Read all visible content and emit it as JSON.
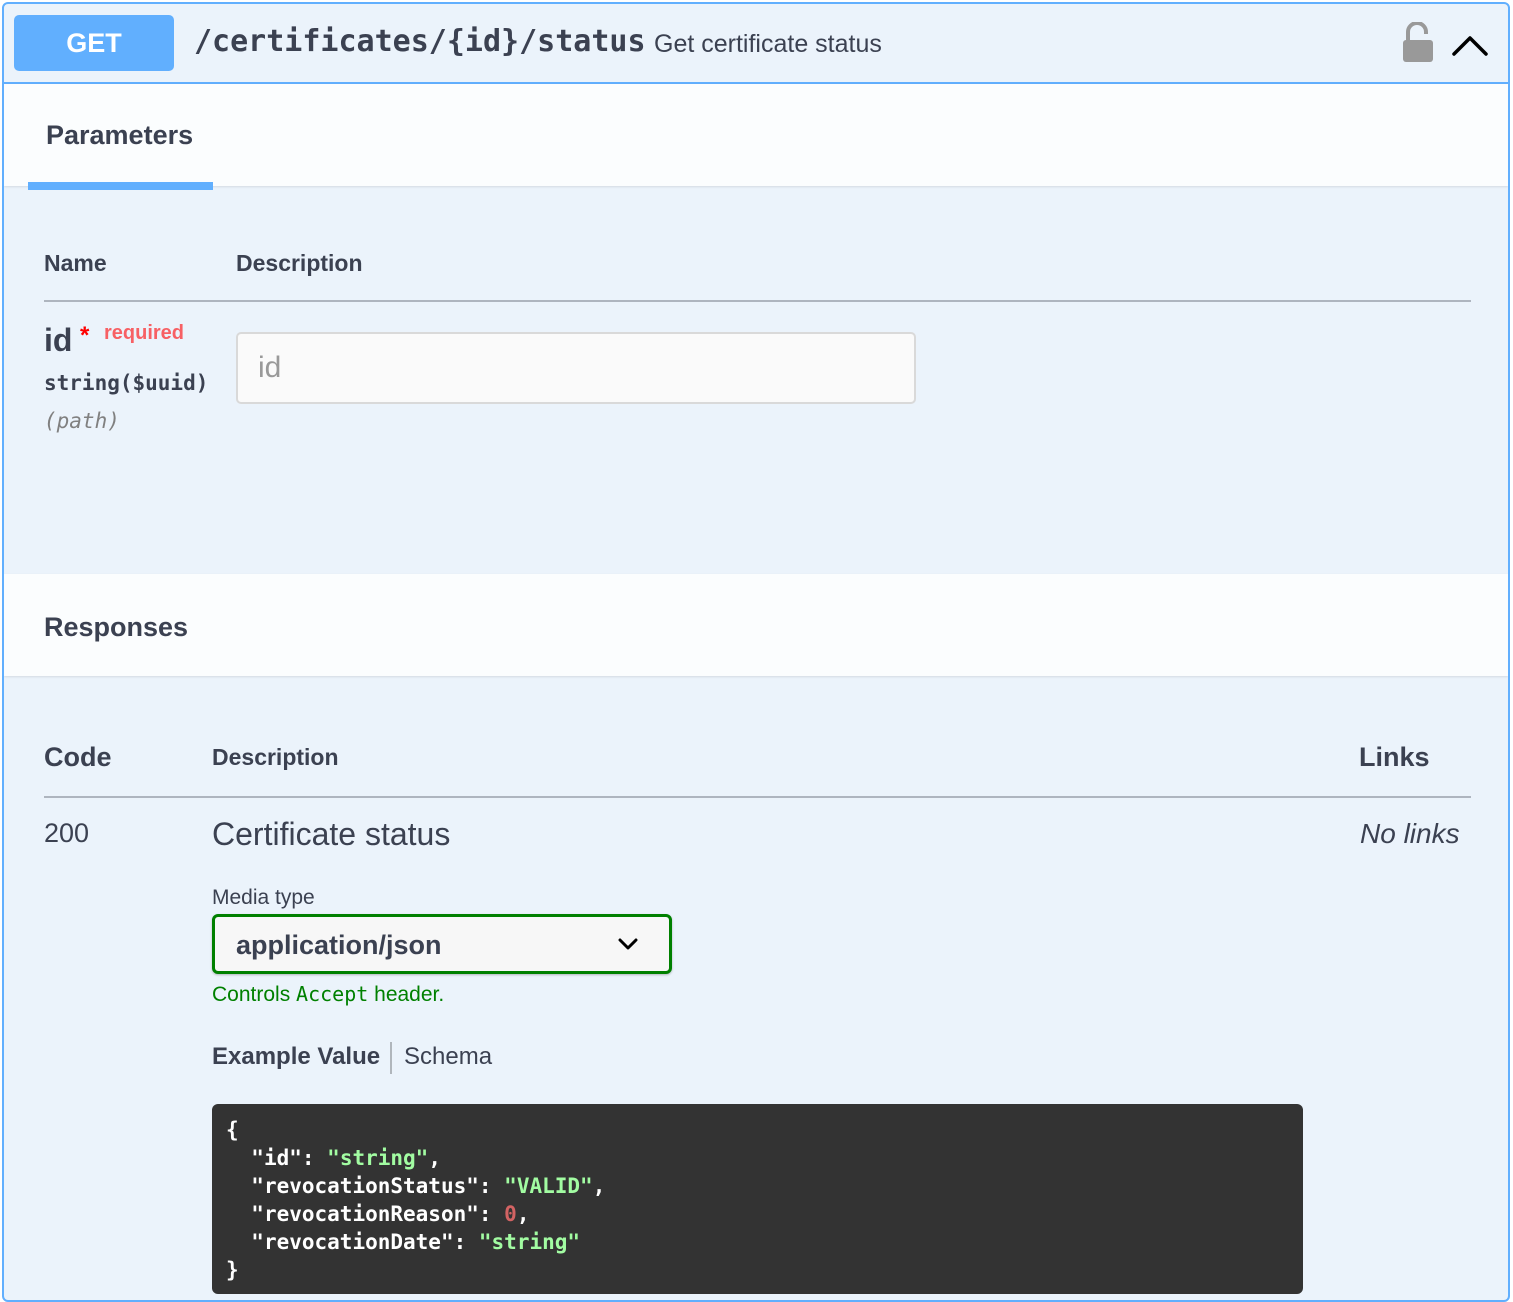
{
  "endpoint": {
    "method": "GET",
    "path": "/certificates/{id}/status",
    "summary": "Get certificate status"
  },
  "icons": {
    "lock": "lock-unlocked-icon",
    "collapse": "chevron-up-icon",
    "dropdown": "chevron-down-icon"
  },
  "parameters": {
    "tab_label": "Parameters",
    "col_name": "Name",
    "col_description": "Description",
    "items": [
      {
        "name": "id",
        "required_star": "*",
        "required_label": "required",
        "type": "string($uuid)",
        "in": "(path)",
        "placeholder": "id"
      }
    ]
  },
  "responses": {
    "title": "Responses",
    "col_code": "Code",
    "col_description": "Description",
    "col_links": "Links",
    "items": [
      {
        "code": "200",
        "description": "Certificate status",
        "links": "No links",
        "media_type_label": "Media type",
        "media_type": "application/json",
        "controls_prefix": "Controls",
        "controls_code": "Accept",
        "controls_suffix": "header.",
        "tab_example": "Example Value",
        "tab_schema": "Schema",
        "example": {
          "k_id": "\"id\"",
          "v_id": "\"string\"",
          "k_status": "\"revocationStatus\"",
          "v_status": "\"VALID\"",
          "k_reason": "\"revocationReason\"",
          "v_reason": "0",
          "k_date": "\"revocationDate\"",
          "v_date": "\"string\""
        }
      }
    ]
  },
  "colors": {
    "get_blue": "#61affe",
    "panel_bg": "#ebf3fb",
    "required_red": "#ff0000",
    "media_green": "#008000",
    "code_bg": "#333333",
    "json_string": "#a2fca2",
    "json_number": "#d36363"
  }
}
